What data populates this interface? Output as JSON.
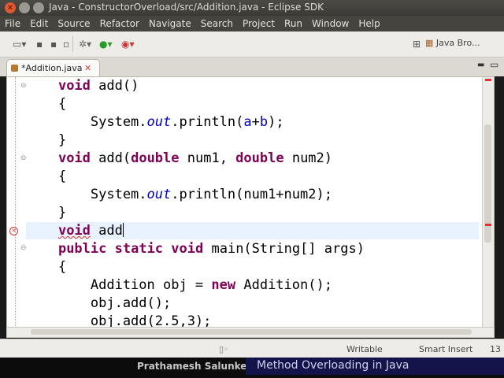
{
  "window": {
    "title": "Java - ConstructorOverload/src/Addition.java - Eclipse SDK"
  },
  "menu": [
    "File",
    "Edit",
    "Source",
    "Refactor",
    "Navigate",
    "Search",
    "Project",
    "Run",
    "Window",
    "Help"
  ],
  "toolbar": {
    "perspective_label": "Java Bro..."
  },
  "editor": {
    "tab_label": "*Addition.java"
  },
  "code_lines": [
    "void add()",
    "{",
    "System.out.println(a+b);",
    "}",
    "void add(double num1, double num2)",
    "{",
    "System.out.println(num1+num2);",
    "}",
    "void add",
    "public static void main(String[] args)",
    "{",
    "Addition obj = new Addition();",
    "obj.add();",
    "obj.add(2.5,3);"
  ],
  "status": {
    "writable": "Writable",
    "insert_mode": "Smart Insert",
    "position": "13"
  },
  "caption": {
    "author": "Prathamesh Salunke",
    "title": "Method Overloading in Java"
  }
}
